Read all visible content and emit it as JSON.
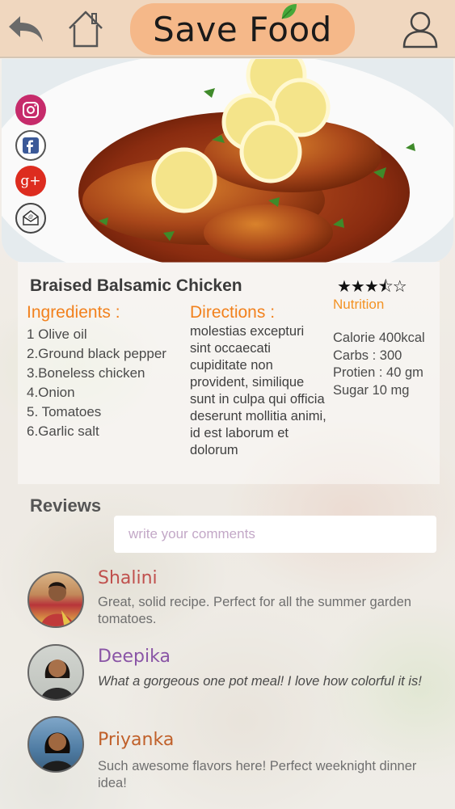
{
  "header": {
    "title": "Save Food",
    "back_icon": "back-arrow-icon",
    "home_icon": "home-icon",
    "profile_icon": "user-profile-icon"
  },
  "social": [
    {
      "name": "instagram-icon",
      "color": "#e1306c"
    },
    {
      "name": "facebook-icon",
      "color": "#3b5998"
    },
    {
      "name": "google-plus-icon",
      "color": "#dd2c1f"
    },
    {
      "name": "email-icon",
      "color": "#333333"
    }
  ],
  "recipe": {
    "title": "Braised Balsamic Chicken",
    "rating_stars": "★★★⯪☆",
    "rating_value": 3.5,
    "rating_max": 5,
    "ingredients_label": "Ingredients :",
    "ingredients": [
      "1 Olive oil",
      "2.Ground black pepper",
      "3.Boneless chicken",
      "4.Onion",
      "5. Tomatoes",
      "6.Garlic salt"
    ],
    "directions_label": "Directions :",
    "directions": "molestias excepturi sint occaecati cupiditate non provident, similique sunt in culpa qui officia deserunt mollitia animi, id est laborum et dolorum",
    "nutrition_label": "Nutrition",
    "nutrition": [
      "Calorie 400kcal",
      "Carbs : 300",
      "Protien : 40 gm",
      "Sugar 10 mg"
    ]
  },
  "reviews": {
    "label": "Reviews",
    "input_placeholder": "write your comments",
    "items": [
      {
        "name": "Shalini",
        "name_color": "#c0504d",
        "text": "Great, solid recipe.  Perfect for all the summer garden tomatoes."
      },
      {
        "name": "Deepika",
        "name_color": "#8a55a6",
        "text": "What a gorgeous one pot meal! I love how colorful it is!"
      },
      {
        "name": "Priyanka",
        "name_color": "#c0602a",
        "text": "Such awesome flavors here! Perfect weeknight dinner idea!"
      }
    ]
  },
  "colors": {
    "header_bg": "#f0d7bf",
    "title_pill": "#f5b889",
    "section_orange": "#f2811d"
  }
}
